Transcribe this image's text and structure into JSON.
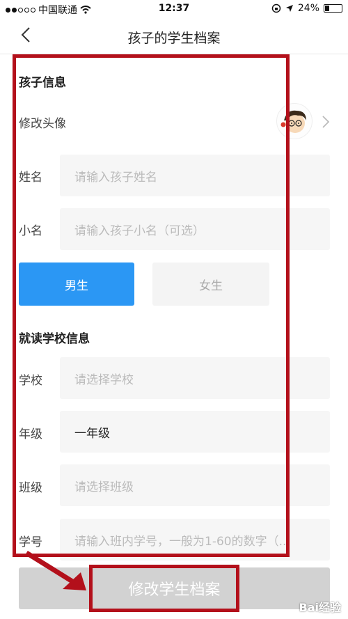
{
  "status_bar": {
    "carrier": "中国联通",
    "time": "12:37",
    "battery": "24%",
    "battery_level": 0.24
  },
  "nav": {
    "title": "孩子的学生档案"
  },
  "child_info": {
    "section_title": "孩子信息",
    "avatar_label": "修改头像",
    "name_label": "姓名",
    "name_placeholder": "请输入孩子姓名",
    "nickname_label": "小名",
    "nickname_placeholder": "请输入孩子小名（可选）",
    "gender_male": "男生",
    "gender_female": "女生",
    "selected_gender": "男生"
  },
  "school_info": {
    "section_title": "就读学校信息",
    "school_label": "学校",
    "school_placeholder": "请选择学校",
    "grade_label": "年级",
    "grade_value": "一年级",
    "class_label": "班级",
    "class_placeholder": "请选择班级",
    "student_no_label": "学号",
    "student_no_placeholder": "请输入班内学号，一般为1-60的数字（..."
  },
  "submit_label": "修改学生档案",
  "watermark": "Bai经验",
  "icons": {
    "back": "chevron-left-icon",
    "avatar": "cartoon-avatar-icon",
    "chevron": "chevron-right-icon",
    "wifi": "wifi-icon",
    "location": "location-arrow-icon",
    "lock": "rotation-lock-icon"
  },
  "colors": {
    "primary": "#2b97f4",
    "annotation": "#b3101b",
    "disabled": "#d2d2d2"
  }
}
